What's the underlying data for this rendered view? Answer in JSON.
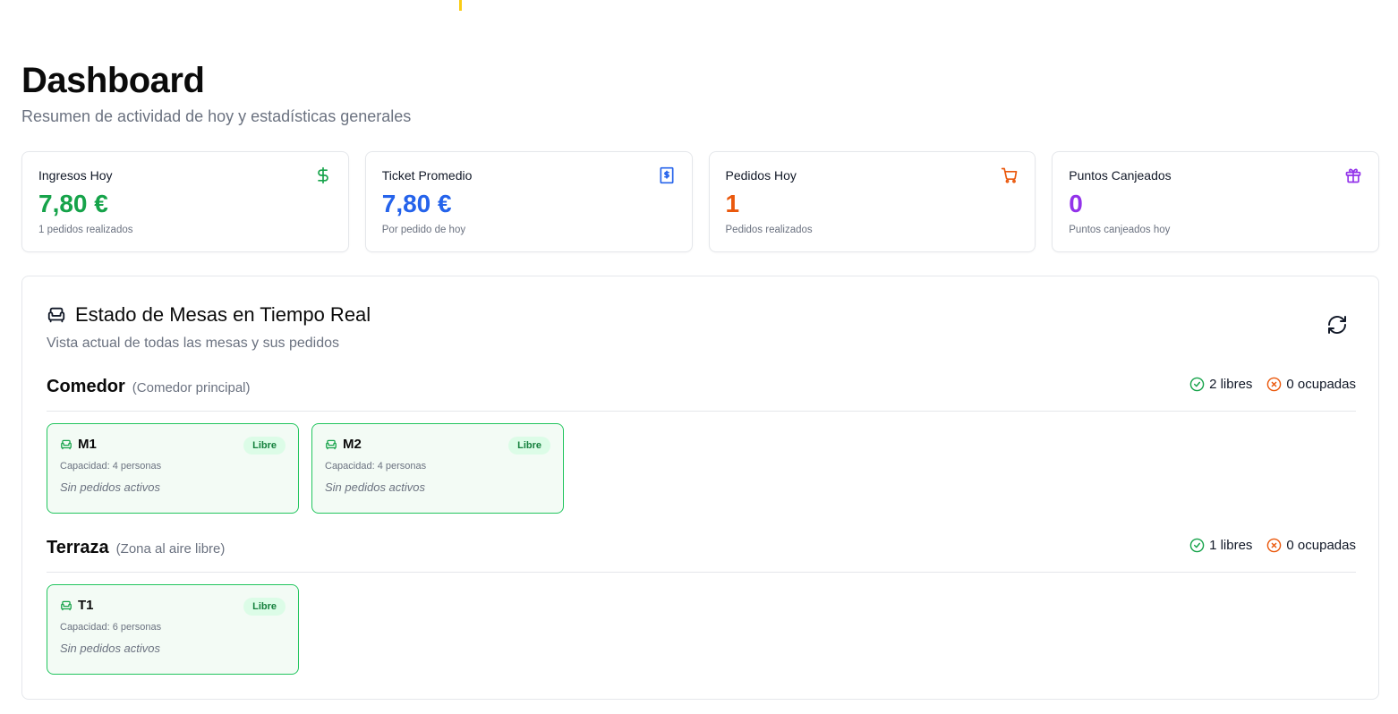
{
  "header": {
    "title": "Dashboard",
    "subtitle": "Resumen de actividad de hoy y estadísticas generales"
  },
  "stats": [
    {
      "label": "Ingresos Hoy",
      "value": "7,80 €",
      "sub": "1 pedidos realizados",
      "icon": "dollar-icon",
      "color": "#16a34a"
    },
    {
      "label": "Ticket Promedio",
      "value": "7,80 €",
      "sub": "Por pedido de hoy",
      "icon": "receipt-icon",
      "color": "#2563eb"
    },
    {
      "label": "Pedidos Hoy",
      "value": "1",
      "sub": "Pedidos realizados",
      "icon": "cart-icon",
      "color": "#ea580c"
    },
    {
      "label": "Puntos Canjeados",
      "value": "0",
      "sub": "Puntos canjeados hoy",
      "icon": "gift-icon",
      "color": "#9333ea"
    }
  ],
  "tables_panel": {
    "title": "Estado de Mesas en Tiempo Real",
    "subtitle": "Vista actual de todas las mesas y sus pedidos",
    "icon": "armchair-icon",
    "refresh_icon": "refresh-icon"
  },
  "zones": [
    {
      "name": "Comedor",
      "description": "(Comedor principal)",
      "free": "2 libres",
      "occupied": "0 ocupadas",
      "tables": [
        {
          "name": "M1",
          "status": "Libre",
          "capacity": "Capacidad: 4 personas",
          "orders": "Sin pedidos activos"
        },
        {
          "name": "M2",
          "status": "Libre",
          "capacity": "Capacidad: 4 personas",
          "orders": "Sin pedidos activos"
        }
      ]
    },
    {
      "name": "Terraza",
      "description": "(Zona al aire libre)",
      "free": "1 libres",
      "occupied": "0 ocupadas",
      "tables": [
        {
          "name": "T1",
          "status": "Libre",
          "capacity": "Capacidad: 6 personas",
          "orders": "Sin pedidos activos"
        }
      ]
    }
  ],
  "colors": {
    "free": "#16a34a",
    "occupied": "#ea580c",
    "table_border": "#22c55e",
    "table_bg": "#f3fbf5"
  }
}
